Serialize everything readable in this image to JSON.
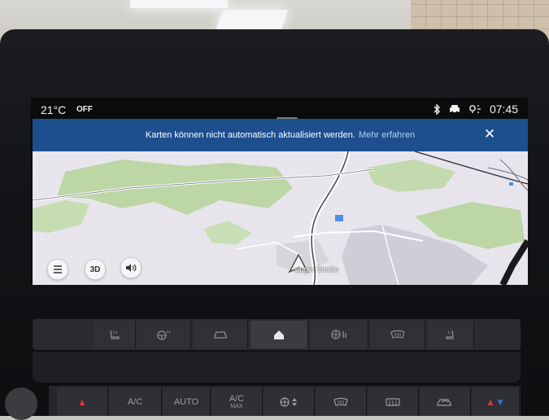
{
  "status_bar": {
    "temperature": "21°C",
    "climate_status": "OFF",
    "time": "07:45",
    "icons": [
      "bluetooth-icon",
      "car-connection-icon",
      "location-signal-icon"
    ]
  },
  "banner": {
    "message": "Karten können nicht automatisch aktualisiert werden.",
    "link": "Mehr erfahren",
    "close_icon": "close-icon"
  },
  "map": {
    "street_name": "singer Straße",
    "buttons": {
      "menu_icon": "menu-icon",
      "view_mode_label": "3D",
      "volume_icon": "volume-icon"
    },
    "colors": {
      "land": "#e8e6ec",
      "forest": "#bcd6a6",
      "water": "#4f8fe0"
    }
  },
  "hardware": {
    "upper_buttons": [
      "heated-seat-icon",
      "heated-steering-icon",
      "car-icon",
      "home-icon",
      "fan-icon",
      "rear-defrost-icon",
      "seat-heat-icon"
    ],
    "lower_buttons": {
      "ac_label": "A/C",
      "auto_label": "AUTO",
      "ac_max_label": "A/C",
      "ac_max_sub": "MAX"
    }
  }
}
